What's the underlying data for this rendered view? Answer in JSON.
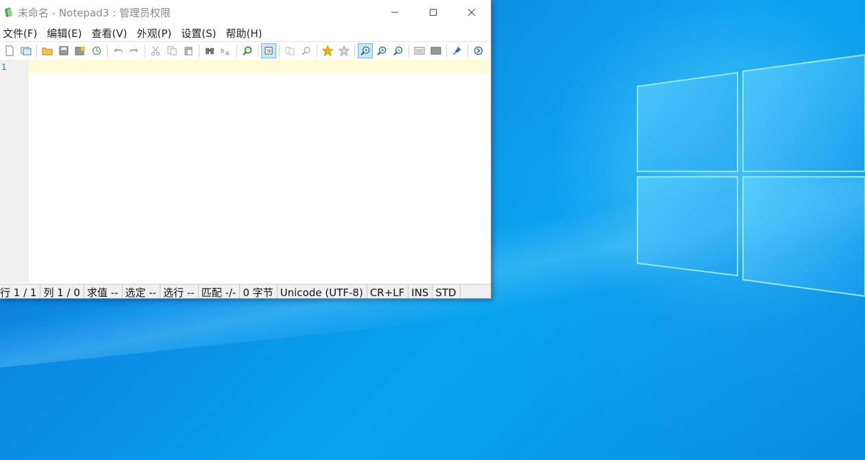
{
  "window": {
    "title": "未命名 - Notepad3 : 管理员权限",
    "controls": {
      "minimize": "─",
      "maximize": "☐",
      "close": "✕"
    }
  },
  "menu": [
    "文件(F)",
    "编辑(E)",
    "查看(V)",
    "外观(P)",
    "设置(S)",
    "帮助(H)"
  ],
  "toolbar": {
    "buttons": [
      "new-file",
      "open-window",
      "open-folder",
      "save",
      "save-as",
      "save-copy",
      "revert",
      "undo",
      "redo",
      "cut",
      "copy",
      "paste",
      "find",
      "replace",
      "find-next",
      "toggle-wrap",
      "copy-block",
      "zoom-find",
      "favorites",
      "add-favorite",
      "zoom-in-active",
      "zoom-in",
      "zoom-out",
      "view-whitespace",
      "screen",
      "pin",
      "exit"
    ]
  },
  "editor": {
    "line_number": "1"
  },
  "status": {
    "line": "行  1 / 1",
    "col": "列  1 / 0",
    "eval": "求值  --",
    "sel": "选定  --",
    "sel_lines": "选行  --",
    "match": "匹配  -/-",
    "bytes": "0 字节",
    "encoding": "Unicode (UTF-8)",
    "eol": "CR+LF",
    "ins": "INS",
    "lexer": "STD"
  },
  "colors": {
    "desktop_blue": "#0b8ee6",
    "current_line": "#fffbd8",
    "gutter": "#f0f0f0",
    "line_number": "#2a7aa8"
  }
}
